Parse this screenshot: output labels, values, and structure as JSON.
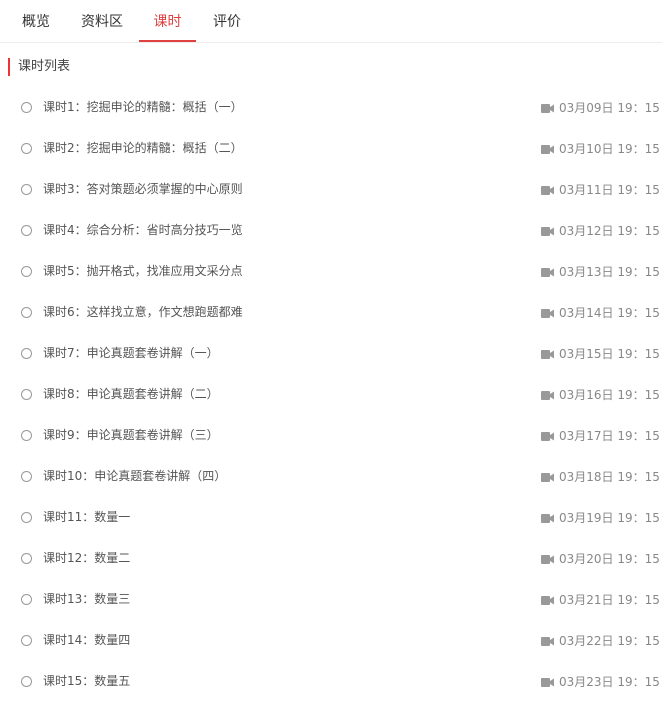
{
  "tabs": [
    {
      "label": "概览"
    },
    {
      "label": "资料区"
    },
    {
      "label": "课时"
    },
    {
      "label": "评价"
    }
  ],
  "active_tab": "课时",
  "section_title": "课时列表",
  "lessons": [
    {
      "title": "课时1：挖掘申论的精髓：概括（一）",
      "time": "03月09日 19：15"
    },
    {
      "title": "课时2：挖掘申论的精髓：概括（二）",
      "time": "03月10日 19：15"
    },
    {
      "title": "课时3：答对策题必须掌握的中心原则",
      "time": "03月11日 19：15"
    },
    {
      "title": "课时4：综合分析：省时高分技巧一览",
      "time": "03月12日 19：15"
    },
    {
      "title": "课时5：抛开格式，找准应用文采分点",
      "time": "03月13日 19：15"
    },
    {
      "title": "课时6：这样找立意，作文想跑题都难",
      "time": "03月14日 19：15"
    },
    {
      "title": "课时7：申论真题套卷讲解（一）",
      "time": "03月15日 19：15"
    },
    {
      "title": "课时8：申论真题套卷讲解（二）",
      "time": "03月16日 19：15"
    },
    {
      "title": "课时9：申论真题套卷讲解（三）",
      "time": "03月17日 19：15"
    },
    {
      "title": "课时10：申论真题套卷讲解（四）",
      "time": "03月18日 19：15"
    },
    {
      "title": "课时11：数量一",
      "time": "03月19日 19：15"
    },
    {
      "title": "课时12：数量二",
      "time": "03月20日 19：15"
    },
    {
      "title": "课时13：数量三",
      "time": "03月21日 19：15"
    },
    {
      "title": "课时14：数量四",
      "time": "03月22日 19：15"
    },
    {
      "title": "课时15：数量五",
      "time": "03月23日 19：15"
    }
  ],
  "icons": {
    "lesson_status": "radio-circle-icon",
    "live_video": "video-camera-icon"
  },
  "colors": {
    "accent": "#e04040",
    "section_bar": "#ee3333",
    "time_text": "#888888",
    "camera_icon": "#999999"
  }
}
